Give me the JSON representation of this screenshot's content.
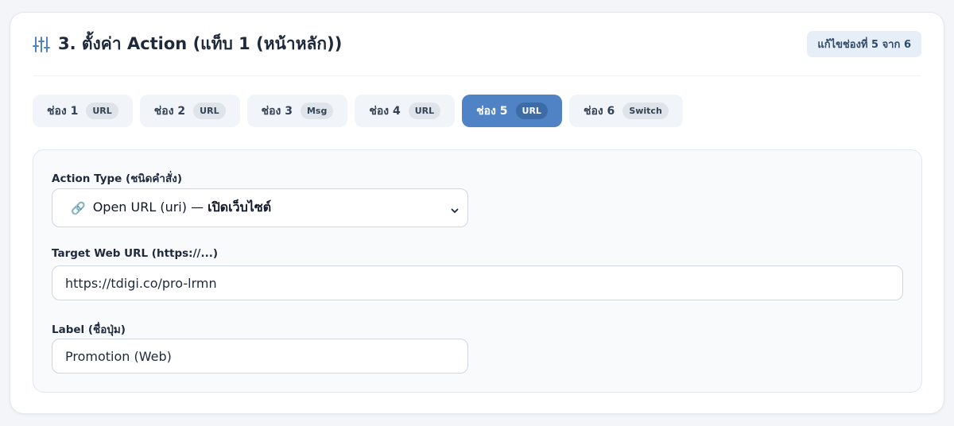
{
  "header": {
    "icon": "sliders-icon",
    "title": "3. ตั้งค่า Action (แท็บ 1 (หน้าหลัก))",
    "edit_badge": "แก้ไขช่องที่ 5 จาก 6"
  },
  "tabs": [
    {
      "label": "ช่อง 1",
      "type": "URL",
      "active": false
    },
    {
      "label": "ช่อง 2",
      "type": "URL",
      "active": false
    },
    {
      "label": "ช่อง 3",
      "type": "Msg",
      "active": false
    },
    {
      "label": "ช่อง 4",
      "type": "URL",
      "active": false
    },
    {
      "label": "ช่อง 5",
      "type": "URL",
      "active": true
    },
    {
      "label": "ช่อง 6",
      "type": "Switch",
      "active": false
    }
  ],
  "form": {
    "action_type": {
      "label": "Action Type (ชนิดคำสั่ง)",
      "icon": "link-icon",
      "selected_prefix": "Open URL (uri) — ",
      "selected_suffix": "เปิดเว็บไซต์"
    },
    "target_url": {
      "label": "Target Web URL (https://...)",
      "value": "https://tdigi.co/pro-lrmn"
    },
    "button_label": {
      "label": "Label (ชื่อปุ่ม)",
      "value": "Promotion (Web)"
    }
  },
  "colors": {
    "accent": "#4f83c5",
    "badge_bg": "#e6eef8"
  }
}
